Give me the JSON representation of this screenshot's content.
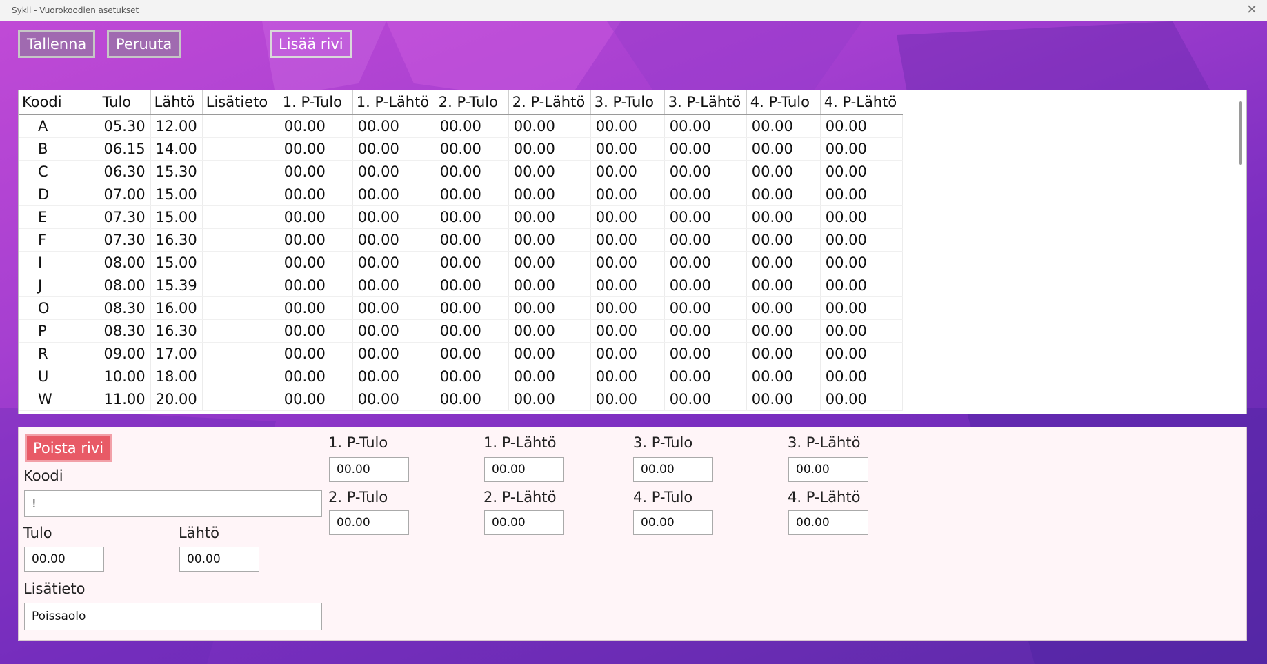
{
  "window": {
    "title": "Sykli - Vuorokoodien asetukset",
    "close_glyph": "✕"
  },
  "toolbar": {
    "save": "Tallenna",
    "cancel": "Peruuta",
    "add_row": "Lisää rivi"
  },
  "table": {
    "columns": [
      "Koodi",
      "Tulo",
      "Lähtö",
      "Lisätieto",
      "1. P-Tulo",
      "1. P-Lähtö",
      "2. P-Tulo",
      "2. P-Lähtö",
      "3. P-Tulo",
      "3. P-Lähtö",
      "4. P-Tulo",
      "4. P-Lähtö"
    ],
    "rows": [
      [
        "A",
        "05.30",
        "12.00",
        "",
        "00.00",
        "00.00",
        "00.00",
        "00.00",
        "00.00",
        "00.00",
        "00.00",
        "00.00"
      ],
      [
        "B",
        "06.15",
        "14.00",
        "",
        "00.00",
        "00.00",
        "00.00",
        "00.00",
        "00.00",
        "00.00",
        "00.00",
        "00.00"
      ],
      [
        "C",
        "06.30",
        "15.30",
        "",
        "00.00",
        "00.00",
        "00.00",
        "00.00",
        "00.00",
        "00.00",
        "00.00",
        "00.00"
      ],
      [
        "D",
        "07.00",
        "15.00",
        "",
        "00.00",
        "00.00",
        "00.00",
        "00.00",
        "00.00",
        "00.00",
        "00.00",
        "00.00"
      ],
      [
        "E",
        "07.30",
        "15.00",
        "",
        "00.00",
        "00.00",
        "00.00",
        "00.00",
        "00.00",
        "00.00",
        "00.00",
        "00.00"
      ],
      [
        "F",
        "07.30",
        "16.30",
        "",
        "00.00",
        "00.00",
        "00.00",
        "00.00",
        "00.00",
        "00.00",
        "00.00",
        "00.00"
      ],
      [
        "I",
        "08.00",
        "15.00",
        "",
        "00.00",
        "00.00",
        "00.00",
        "00.00",
        "00.00",
        "00.00",
        "00.00",
        "00.00"
      ],
      [
        "J",
        "08.00",
        "15.39",
        "",
        "00.00",
        "00.00",
        "00.00",
        "00.00",
        "00.00",
        "00.00",
        "00.00",
        "00.00"
      ],
      [
        "O",
        "08.30",
        "16.00",
        "",
        "00.00",
        "00.00",
        "00.00",
        "00.00",
        "00.00",
        "00.00",
        "00.00",
        "00.00"
      ],
      [
        "P",
        "08.30",
        "16.30",
        "",
        "00.00",
        "00.00",
        "00.00",
        "00.00",
        "00.00",
        "00.00",
        "00.00",
        "00.00"
      ],
      [
        "R",
        "09.00",
        "17.00",
        "",
        "00.00",
        "00.00",
        "00.00",
        "00.00",
        "00.00",
        "00.00",
        "00.00",
        "00.00"
      ],
      [
        "U",
        "10.00",
        "18.00",
        "",
        "00.00",
        "00.00",
        "00.00",
        "00.00",
        "00.00",
        "00.00",
        "00.00",
        "00.00"
      ],
      [
        "W",
        "11.00",
        "20.00",
        "",
        "00.00",
        "00.00",
        "00.00",
        "00.00",
        "00.00",
        "00.00",
        "00.00",
        "00.00"
      ]
    ]
  },
  "editor": {
    "delete_row": "Poista rivi",
    "koodi": {
      "label": "Koodi",
      "value": "!"
    },
    "tulo": {
      "label": "Tulo",
      "value": "00.00"
    },
    "lahto": {
      "label": "Lähtö",
      "value": "00.00"
    },
    "lisatieto": {
      "label": "Lisätieto",
      "value": "Poissaolo"
    },
    "p1_tulo": {
      "label": "1. P-Tulo",
      "value": "00.00"
    },
    "p1_lahto": {
      "label": "1. P-Lähtö",
      "value": "00.00"
    },
    "p2_tulo": {
      "label": "2. P-Tulo",
      "value": "00.00"
    },
    "p2_lahto": {
      "label": "2. P-Lähtö",
      "value": "00.00"
    },
    "p3_tulo": {
      "label": "3. P-Tulo",
      "value": "00.00"
    },
    "p3_lahto": {
      "label": "3. P-Lähtö",
      "value": "00.00"
    },
    "p4_tulo": {
      "label": "4. P-Tulo",
      "value": "00.00"
    },
    "p4_lahto": {
      "label": "4. P-Lähtö",
      "value": "00.00"
    }
  },
  "colors": {
    "accent": "#b044d4",
    "delete": "#e85a66",
    "editor_bg": "#fff5f8"
  }
}
